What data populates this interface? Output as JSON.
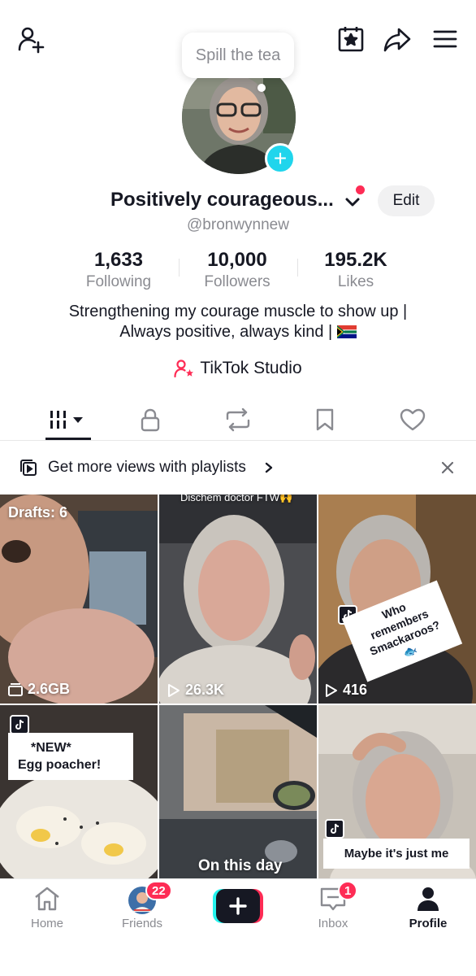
{
  "header": {
    "add_friend_icon": "add-user-icon",
    "calendar_icon": "calendar-star-icon",
    "share_icon": "share-arrow-icon",
    "menu_icon": "hamburger-menu-icon"
  },
  "status_bubble": {
    "text": "Spill the tea"
  },
  "profile": {
    "display_name": "Positively courageous...",
    "edit_label": "Edit",
    "username": "@bronwynnew",
    "stats": [
      {
        "value": "1,633",
        "label": "Following"
      },
      {
        "value": "10,000",
        "label": "Followers"
      },
      {
        "value": "195.2K",
        "label": "Likes"
      }
    ],
    "bio_line1": "Strengthening my courage muscle to show up |",
    "bio_line2": "Always positive, always kind |",
    "studio_label": "TikTok Studio"
  },
  "tabs": [
    {
      "name": "videos",
      "icon": "grid-icon",
      "active": true
    },
    {
      "name": "private",
      "icon": "lock-icon"
    },
    {
      "name": "reposts",
      "icon": "repost-icon"
    },
    {
      "name": "favorites",
      "icon": "bookmark-icon"
    },
    {
      "name": "liked",
      "icon": "heart-icon"
    }
  ],
  "promo": {
    "text": "Get more views with playlists"
  },
  "videos": [
    {
      "overlay_top": "Drafts: 6",
      "stat": "2.6GB",
      "stat_icon": "drafts-icon"
    },
    {
      "overlay_top": "Dischem doctor FTW🙌",
      "stat": "26.3K",
      "stat_icon": "play-icon"
    },
    {
      "caption": "Who remembers Smackaroos? 🐟",
      "stat": "416",
      "stat_icon": "play-icon"
    },
    {
      "caption_line1": "*NEW*",
      "caption_line2": "Egg poacher!"
    },
    {
      "caption": "On this day"
    },
    {
      "caption": "Maybe it's just me"
    }
  ],
  "bottom_nav": {
    "home": "Home",
    "friends": "Friends",
    "friends_badge": "22",
    "inbox": "Inbox",
    "inbox_badge": "1",
    "profile": "Profile"
  },
  "colors": {
    "accent_red": "#fe2c55",
    "accent_cyan": "#20d5ec",
    "text_primary": "#161823",
    "text_secondary": "#8a8b91"
  }
}
